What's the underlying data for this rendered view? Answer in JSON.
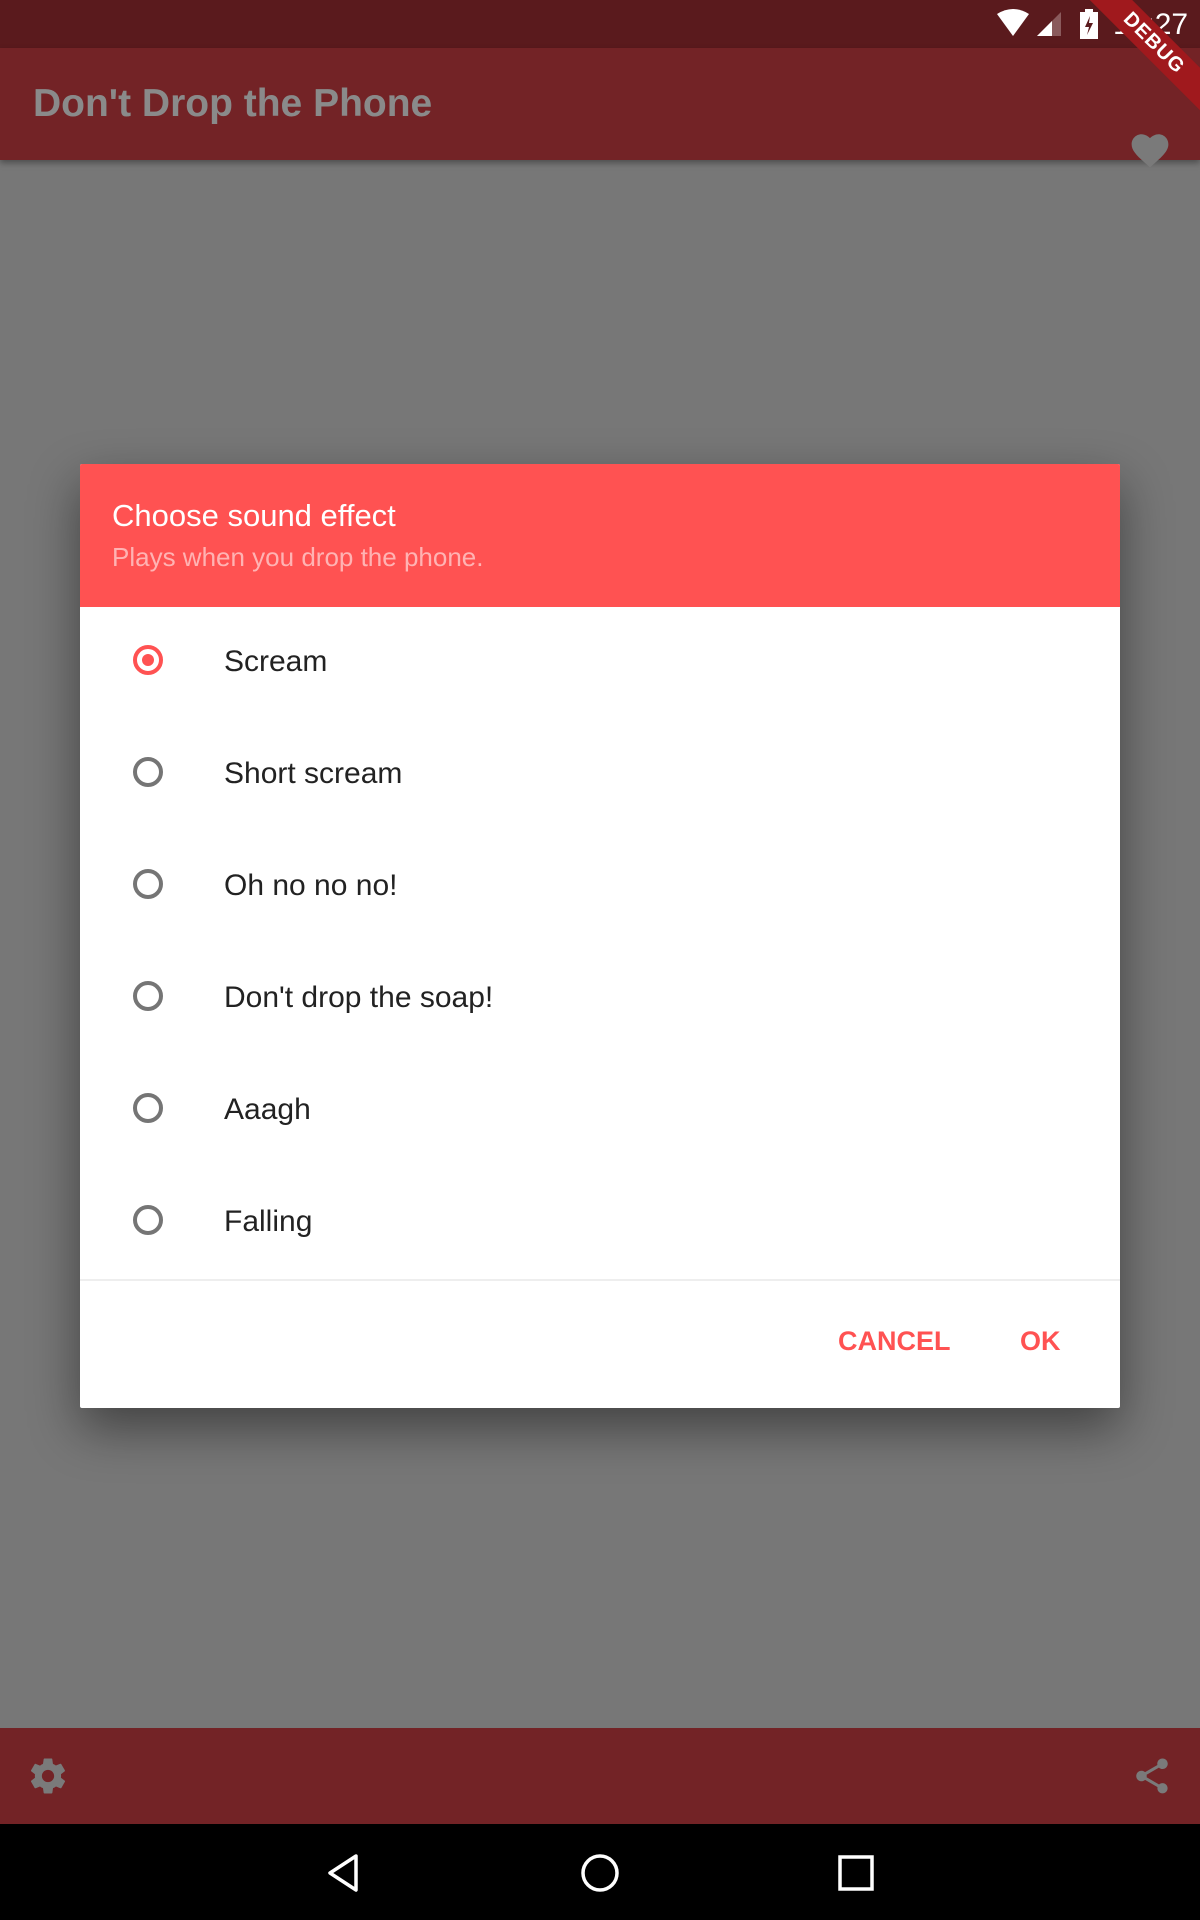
{
  "status_bar": {
    "time": "10:27",
    "icons": [
      "wifi-icon",
      "signal-icon",
      "battery-charging-icon"
    ],
    "debug_banner": "DEBUG"
  },
  "app_bar": {
    "title": "Don't Drop the Phone",
    "action_icon": "heart-icon"
  },
  "dialog": {
    "title": "Choose sound effect",
    "subtitle": "Plays when you drop the phone.",
    "options": [
      {
        "label": "Scream",
        "selected": true
      },
      {
        "label": "Short scream",
        "selected": false
      },
      {
        "label": "Oh no no no!",
        "selected": false
      },
      {
        "label": "Don't drop the soap!",
        "selected": false
      },
      {
        "label": "Aaagh",
        "selected": false
      },
      {
        "label": "Falling",
        "selected": false
      }
    ],
    "cancel_label": "CANCEL",
    "ok_label": "OK"
  },
  "bottom_bar": {
    "left_icon": "settings-icon",
    "right_icon": "share-icon"
  },
  "nav_bar": {
    "buttons": [
      "back",
      "home",
      "recents"
    ]
  },
  "colors": {
    "accent": "#ff5252",
    "primary": "#732326",
    "status_bar": "#5a1a1d",
    "scrim": "#777777"
  }
}
